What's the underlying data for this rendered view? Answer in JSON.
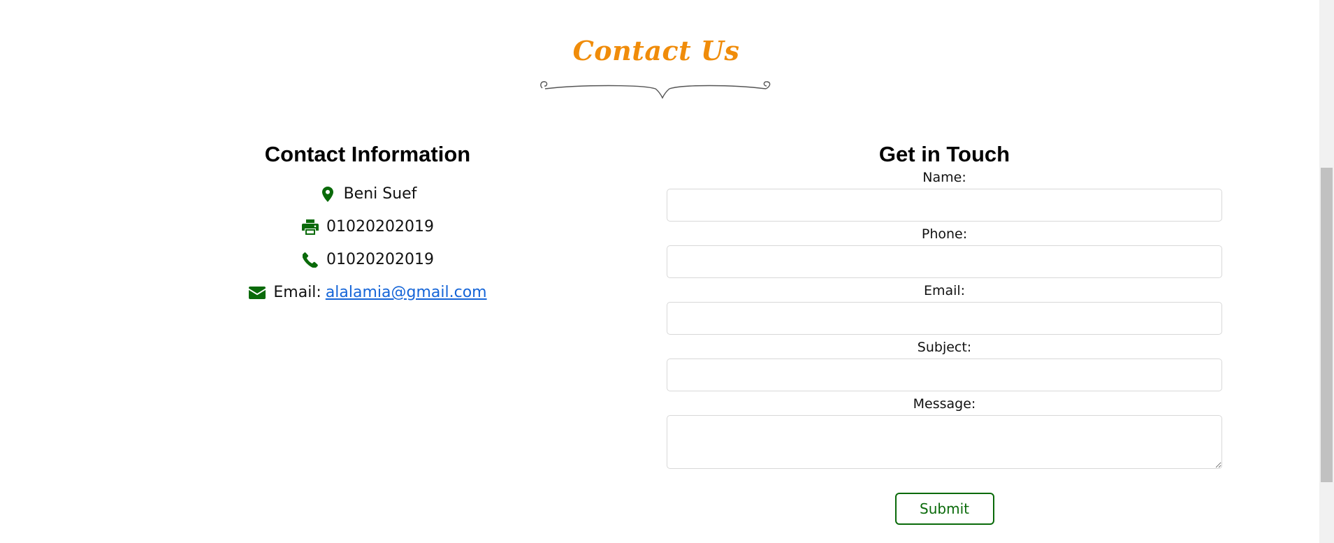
{
  "section": {
    "title": "Contact Us"
  },
  "contact_info": {
    "heading": "Contact Information",
    "items": [
      {
        "icon": "map-marker-icon",
        "text": "Beni Suef"
      },
      {
        "icon": "printer-icon",
        "text": "01020202019"
      },
      {
        "icon": "phone-icon",
        "text": "01020202019"
      },
      {
        "icon": "envelope-icon",
        "label": "Email:",
        "link": "alalamia@gmail.com"
      }
    ]
  },
  "form": {
    "heading": "Get in Touch",
    "fields": {
      "name_label": "Name:",
      "name_value": "",
      "phone_label": "Phone:",
      "phone_value": "",
      "email_label": "Email:",
      "email_value": "",
      "subject_label": "Subject:",
      "subject_value": "",
      "message_label": "Message:",
      "message_value": ""
    },
    "submit_label": "Submit"
  },
  "colors": {
    "accent_title": "#f08c0a",
    "icon_green": "#0a6a0a",
    "link_blue": "#1565d8"
  }
}
